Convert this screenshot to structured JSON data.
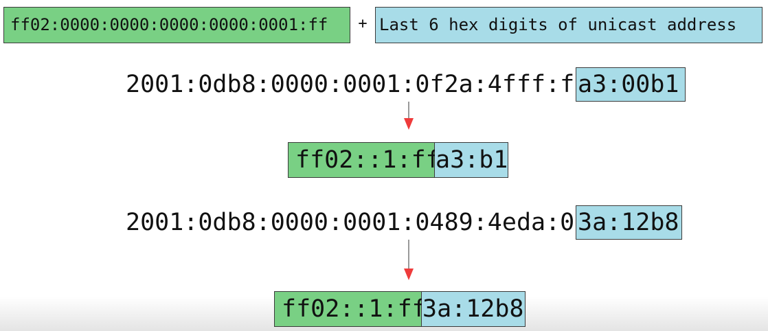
{
  "legend": {
    "prefix": "ff02:0000:0000:0000:0000:0001:ff",
    "operator": "+",
    "suffix_desc": "Last 6 hex digits of unicast address"
  },
  "examples": [
    {
      "unicast_prefix": "2001:0db8:0000:0001:0f2a:4fff:fe",
      "unicast_last6": "a3:00b1",
      "multicast_prefix": "ff02::1:ff",
      "multicast_suffix": "a3:b1"
    },
    {
      "unicast_prefix": "2001:0db8:0000:0001:0489:4eda:07",
      "unicast_last6": "3a:12b8",
      "multicast_prefix": "ff02::1:ff",
      "multicast_suffix": "3a:12b8"
    }
  ],
  "colors": {
    "prefix_fill": "#79d084",
    "suffix_fill": "#a8dce8",
    "arrow": "#ef3b3b"
  }
}
